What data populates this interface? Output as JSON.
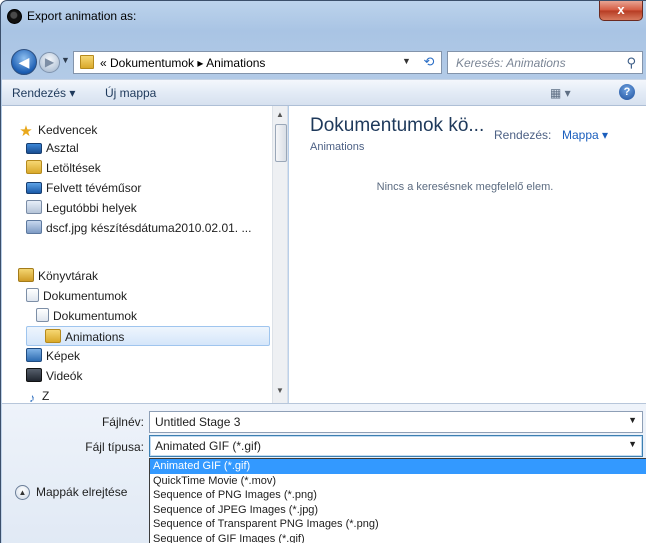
{
  "window": {
    "title": "Export animation as:",
    "close_label": "x"
  },
  "address": {
    "crumbs": "« Dokumentumok ▸ Animations",
    "search_placeholder": "Keresés: Animations"
  },
  "toolbar": {
    "organize": "Rendezés ▾",
    "new_folder": "Új mappa",
    "view": "▦ ▾",
    "help": "?"
  },
  "navigation": {
    "favorites_header": "Kedvencek",
    "favorites": [
      {
        "label": "Asztal",
        "icon": "desktop-icon"
      },
      {
        "label": "Letöltések",
        "icon": "downloads-icon"
      },
      {
        "label": "Felvett tévéműsor",
        "icon": "recorded-tv-icon"
      },
      {
        "label": "Legutóbbi helyek",
        "icon": "recent-places-icon"
      },
      {
        "label": "dscf.jpg készítésdátuma2010.02.01. ...",
        "icon": "image-search-icon"
      }
    ],
    "libraries_header": "Könyvtárak",
    "libraries": [
      {
        "label": "Dokumentumok",
        "icon": "documents-icon"
      },
      {
        "label": "Dokumentumok",
        "icon": "folder-icon"
      },
      {
        "label": "Animations",
        "icon": "folder-icon",
        "selected": true
      },
      {
        "label": "Képek",
        "icon": "pictures-icon"
      },
      {
        "label": "Videók",
        "icon": "videos-icon"
      },
      {
        "label": "Z",
        "icon": "music-icon"
      }
    ]
  },
  "content": {
    "title": "Dokumentumok kö...",
    "subtitle": "Animations",
    "arrange_label": "Rendezés:",
    "arrange_value": "Mappa ▾",
    "empty_message": "Nincs a keresésnek megfelelő elem."
  },
  "form": {
    "filename_label": "Fájlnév:",
    "filename_value": "Untitled Stage 3",
    "filetype_label": "Fájl típusa:",
    "filetype_value": "Animated GIF (*.gif)",
    "hide_folders": "Mappák elrejtése",
    "filetype_options": [
      "Animated GIF (*.gif)",
      "QuickTime Movie (*.mov)",
      "Sequence of PNG Images (*.png)",
      "Sequence of JPEG Images (*.jpg)",
      "Sequence of Transparent PNG Images (*.png)",
      "Sequence of GIF Images (*.gif)"
    ],
    "selected_option_index": 0
  },
  "colors": {
    "accent": "#3399ff",
    "title_blue": "#1e395b",
    "link_blue": "#1a5ebd"
  }
}
